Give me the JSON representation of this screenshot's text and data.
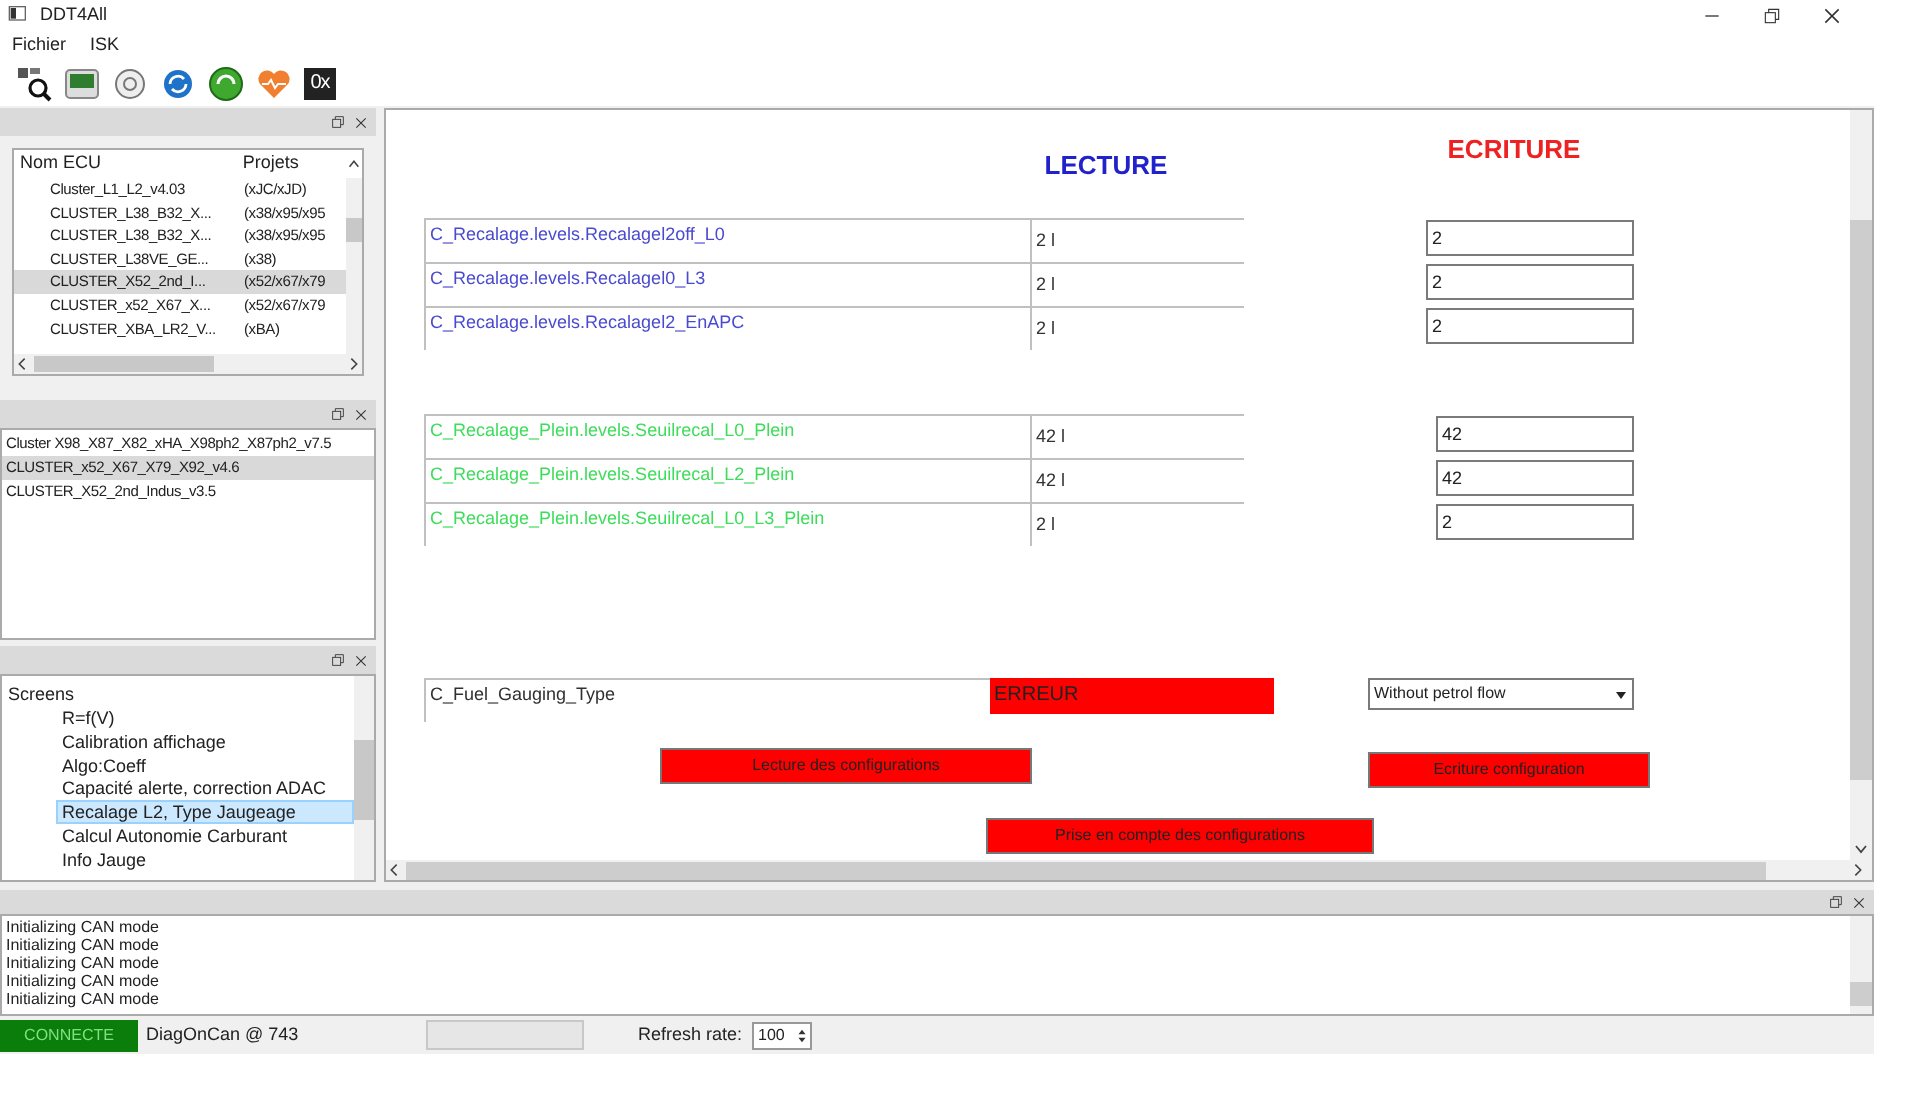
{
  "window": {
    "title": "DDT4All"
  },
  "menu": [
    "Fichier",
    "ISK"
  ],
  "toolbar": {
    "hex_label": "0x"
  },
  "ecu_panel": {
    "columns": [
      "Nom ECU",
      "Projets"
    ],
    "rows": [
      {
        "name": "Cluster_L1_L2_v4.03",
        "project": "(xJC/xJD)",
        "selected": false
      },
      {
        "name": "CLUSTER_L38_B32_X...",
        "project": "(x38/x95/x95",
        "selected": false
      },
      {
        "name": "CLUSTER_L38_B32_X...",
        "project": "(x38/x95/x95",
        "selected": false
      },
      {
        "name": "CLUSTER_L38VE_GE...",
        "project": "(x38)",
        "selected": false
      },
      {
        "name": "CLUSTER_X52_2nd_I...",
        "project": "(x52/x67/x79",
        "selected": true
      },
      {
        "name": "CLUSTER_x52_X67_X...",
        "project": "(x52/x67/x79",
        "selected": false
      },
      {
        "name": "CLUSTER_XBA_LR2_V...",
        "project": "(xBA)",
        "selected": false
      }
    ]
  },
  "versions": [
    {
      "label": "Cluster X98_X87_X82_xHA_X98ph2_X87ph2_v7.5",
      "selected": false
    },
    {
      "label": "CLUSTER_x52_X67_X79_X92_v4.6",
      "selected": true
    },
    {
      "label": "CLUSTER_X52_2nd_Indus_v3.5",
      "selected": false
    }
  ],
  "screens": {
    "label": "Screens",
    "children": [
      {
        "label": "R=f(V)",
        "selected": false
      },
      {
        "label": "Calibration affichage",
        "selected": false
      },
      {
        "label": "Algo:Coeff",
        "selected": false
      },
      {
        "label": "Capacité alerte, correction ADAC",
        "selected": false
      },
      {
        "label": "Recalage L2, Type Jaugeage",
        "selected": true
      },
      {
        "label": "Calcul Autonomie Carburant",
        "selected": false
      },
      {
        "label": "Info Jauge",
        "selected": false
      }
    ]
  },
  "form": {
    "read_title": "LECTURE",
    "write_title": "ECRITURE",
    "sections": [
      {
        "rows": [
          {
            "kind": "numeric",
            "label": "C_Recalage.levels.Recalagel2off_L0",
            "color": "#4a4ad0",
            "reading": "2 l",
            "value": "2"
          },
          {
            "kind": "numeric",
            "label": "C_Recalage.levels.Recalagel0_L3",
            "color": "#4a4ad0",
            "reading": "2 l",
            "value": "2"
          },
          {
            "kind": "numeric",
            "label": "C_Recalage.levels.Recalagel2_EnAPC",
            "color": "#4a4ad0",
            "reading": "2 l",
            "value": "2"
          }
        ]
      },
      {
        "rows": [
          {
            "kind": "numeric",
            "label": "C_Recalage_Plein.levels.Seuilrecal_L0_Plein",
            "color": "#3ddc5a",
            "reading": "42 l",
            "value": "42"
          },
          {
            "kind": "numeric",
            "label": "C_Recalage_Plein.levels.Seuilrecal_L2_Plein",
            "color": "#3ddc5a",
            "reading": "42 l",
            "value": "42"
          },
          {
            "kind": "numeric",
            "label": "C_Recalage_Plein.levels.Seuilrecal_L0_L3_Plein",
            "color": "#3ddc5a",
            "reading": "2 l",
            "value": "2"
          }
        ]
      },
      {
        "rows": [
          {
            "kind": "enum",
            "label": "C_Fuel_Gauging_Type",
            "color": "#303030",
            "reading": "ERREUR",
            "value": "Without petrol flow"
          }
        ]
      }
    ],
    "buttons": [
      "Lecture des configurations",
      "Ecriture configuration",
      "Prise en compte des configurations"
    ]
  },
  "log": [
    "Initializing CAN mode",
    "Initializing CAN mode",
    "Initializing CAN mode",
    "Initializing CAN mode",
    "Initializing CAN mode"
  ],
  "status_bar": {
    "connection": "CONNECTE",
    "connected": true,
    "protocol": "DiagOnCan @ 743",
    "refresh_label": "Refresh rate:",
    "refresh_value": "100"
  }
}
